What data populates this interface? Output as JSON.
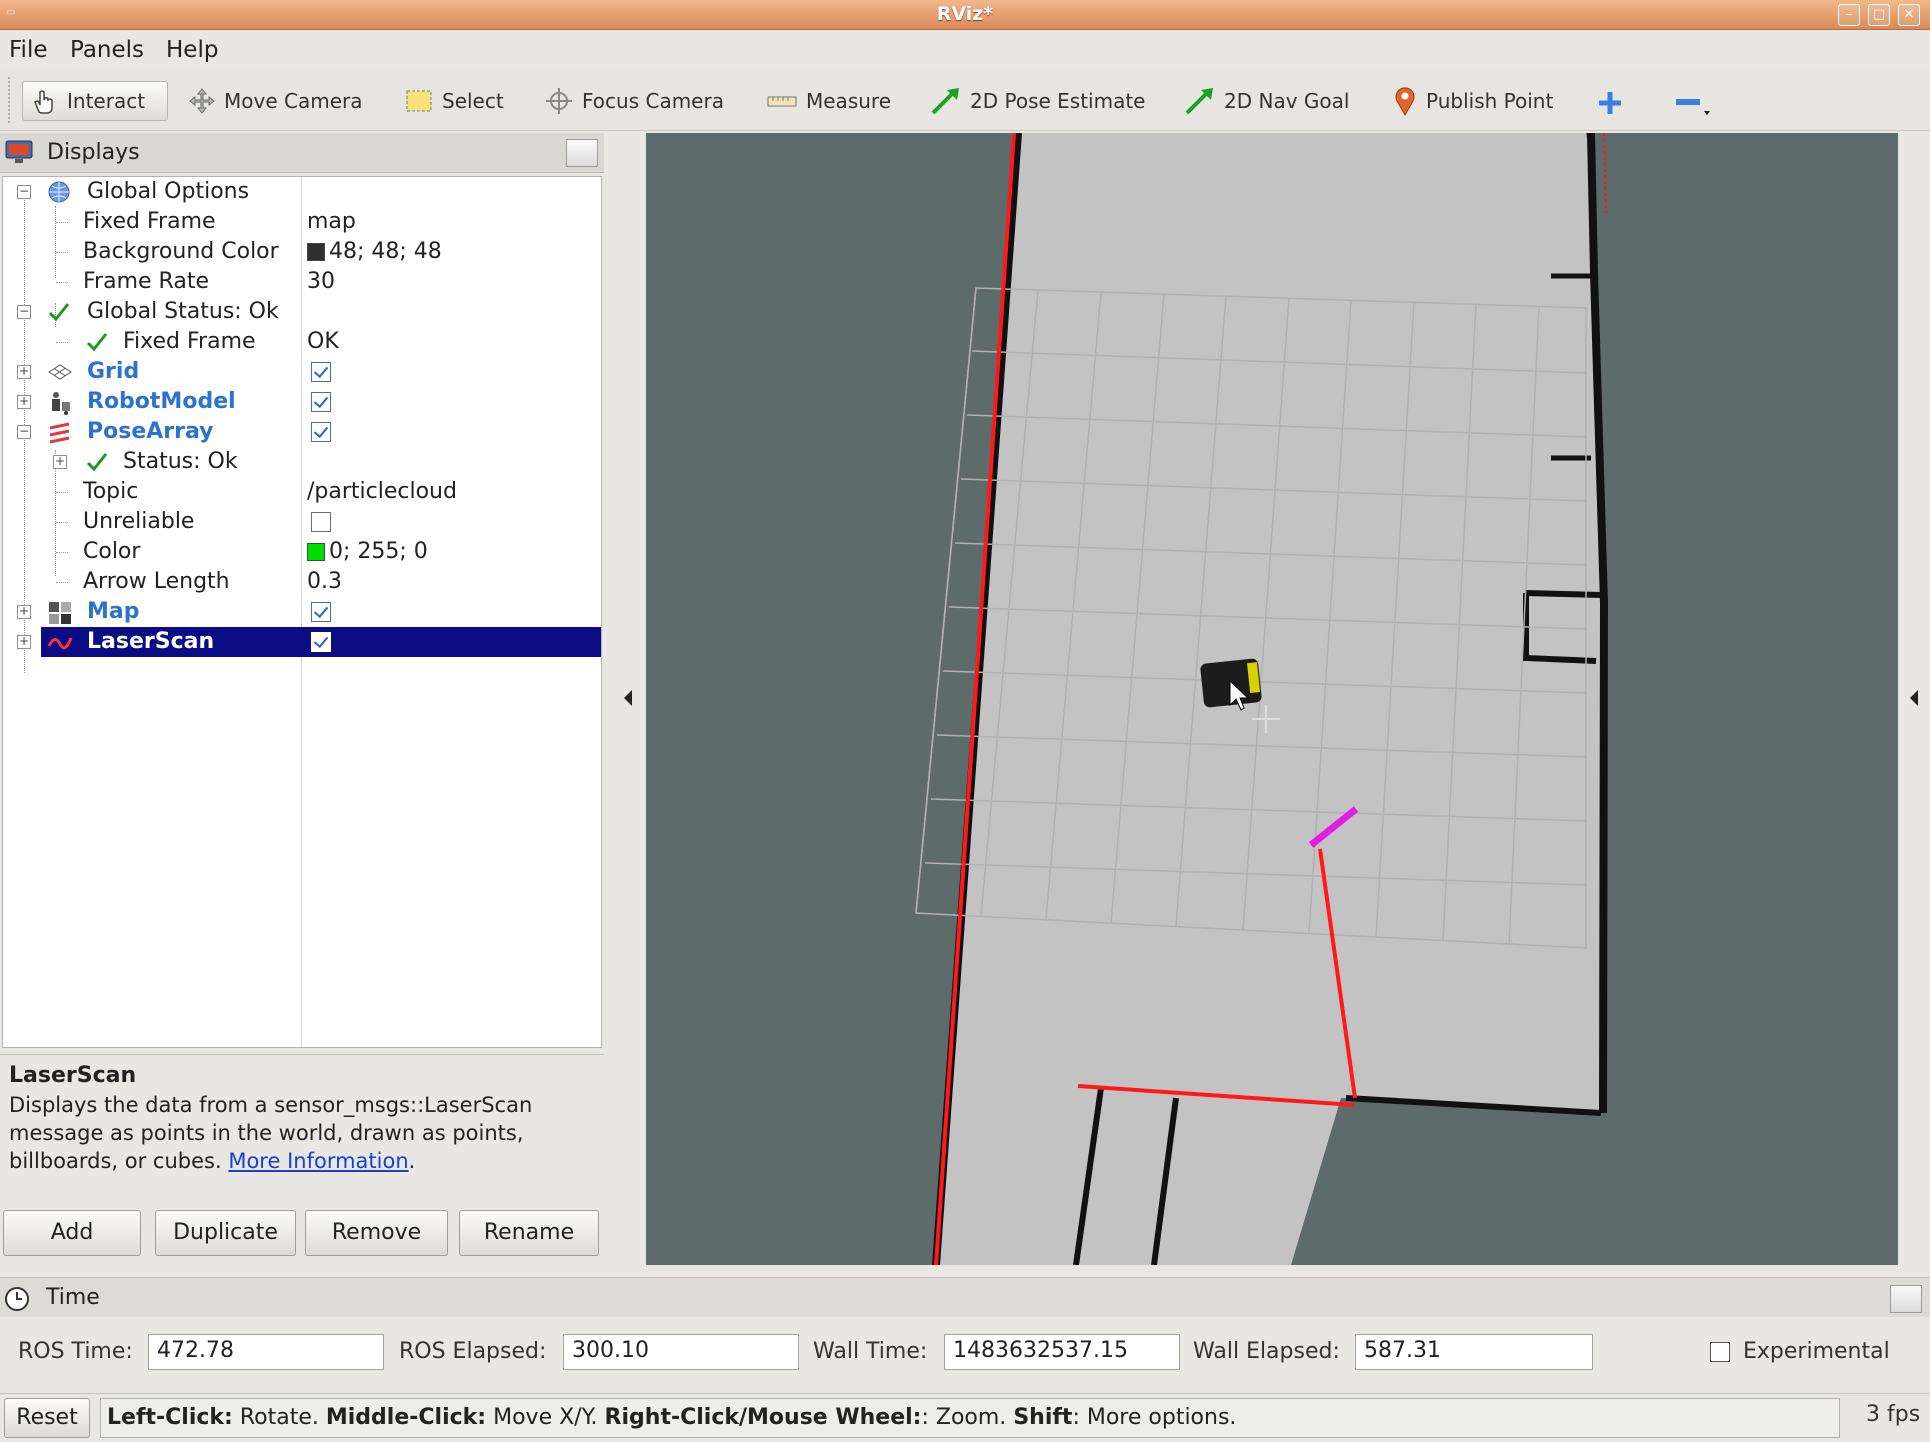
{
  "window": {
    "title": "RViz*"
  },
  "menu": [
    {
      "label": "File"
    },
    {
      "label": "Panels"
    },
    {
      "label": "Help"
    }
  ],
  "toolbar": {
    "tools": [
      {
        "label": "Interact",
        "icon": "hand-pointer-icon",
        "active": true
      },
      {
        "label": "Move Camera",
        "icon": "move-camera-icon"
      },
      {
        "label": "Select",
        "icon": "select-box-icon"
      },
      {
        "label": "Focus Camera",
        "icon": "focus-target-icon"
      },
      {
        "label": "Measure",
        "icon": "ruler-icon"
      },
      {
        "label": "2D Pose Estimate",
        "icon": "green-arrow-icon"
      },
      {
        "label": "2D Nav Goal",
        "icon": "green-arrow-icon"
      },
      {
        "label": "Publish Point",
        "icon": "map-pin-icon"
      }
    ]
  },
  "displays": {
    "title": "Displays",
    "rows": {
      "global_options": {
        "name": "Global Options"
      },
      "fixed_frame": {
        "name": "Fixed Frame",
        "value": "map"
      },
      "background_color": {
        "name": "Background Color",
        "value": "48; 48; 48",
        "color": "#303030"
      },
      "frame_rate": {
        "name": "Frame Rate",
        "value": "30"
      },
      "global_status": {
        "name": "Global Status: Ok"
      },
      "fixed_frame_status": {
        "name": "Fixed Frame",
        "value": "OK"
      },
      "grid": {
        "name": "Grid",
        "checked": true
      },
      "robot_model": {
        "name": "RobotModel",
        "checked": true
      },
      "pose_array": {
        "name": "PoseArray",
        "checked": true
      },
      "pose_status": {
        "name": "Status: Ok"
      },
      "topic": {
        "name": "Topic",
        "value": "/particlecloud"
      },
      "unreliable": {
        "name": "Unreliable",
        "checked": false
      },
      "color": {
        "name": "Color",
        "value": "0; 255; 0",
        "color": "#00ff00"
      },
      "arrow_length": {
        "name": "Arrow Length",
        "value": "0.3"
      },
      "map": {
        "name": "Map",
        "checked": true
      },
      "laser_scan": {
        "name": "LaserScan",
        "checked": true,
        "selected": true
      }
    }
  },
  "description": {
    "title": "LaserScan",
    "body": "Displays the data from a sensor_msgs::LaserScan message as points in the world, drawn as points, billboards, or cubes.",
    "link": "More Information",
    "trailing": "."
  },
  "buttons": {
    "add": "Add",
    "duplicate": "Duplicate",
    "remove": "Remove",
    "rename": "Rename"
  },
  "time": {
    "title": "Time",
    "ros_time_label": "ROS Time:",
    "ros_time": "472.78",
    "ros_elapsed_label": "ROS Elapsed:",
    "ros_elapsed": "300.10",
    "wall_time_label": "Wall Time:",
    "wall_time": "1483632537.15",
    "wall_elapsed_label": "Wall Elapsed:",
    "wall_elapsed": "587.31",
    "experimental_label": "Experimental",
    "experimental": false
  },
  "status": {
    "reset": "Reset",
    "parts": [
      {
        "bold": "Left-Click:",
        "text": " Rotate. "
      },
      {
        "bold": "Middle-Click:",
        "text": " Move X/Y. "
      },
      {
        "bold": "Right-Click/Mouse Wheel:",
        "text": ": Zoom. "
      },
      {
        "bold": "Shift",
        "text": ": More options."
      }
    ],
    "fps": "3 fps"
  },
  "colors": {
    "viewport_bg": "#5d6c6b",
    "map_free": "#c4c3c3",
    "laser": "#ff1a1a",
    "selection": "#0b0b86",
    "link": "#1a3fd6"
  }
}
